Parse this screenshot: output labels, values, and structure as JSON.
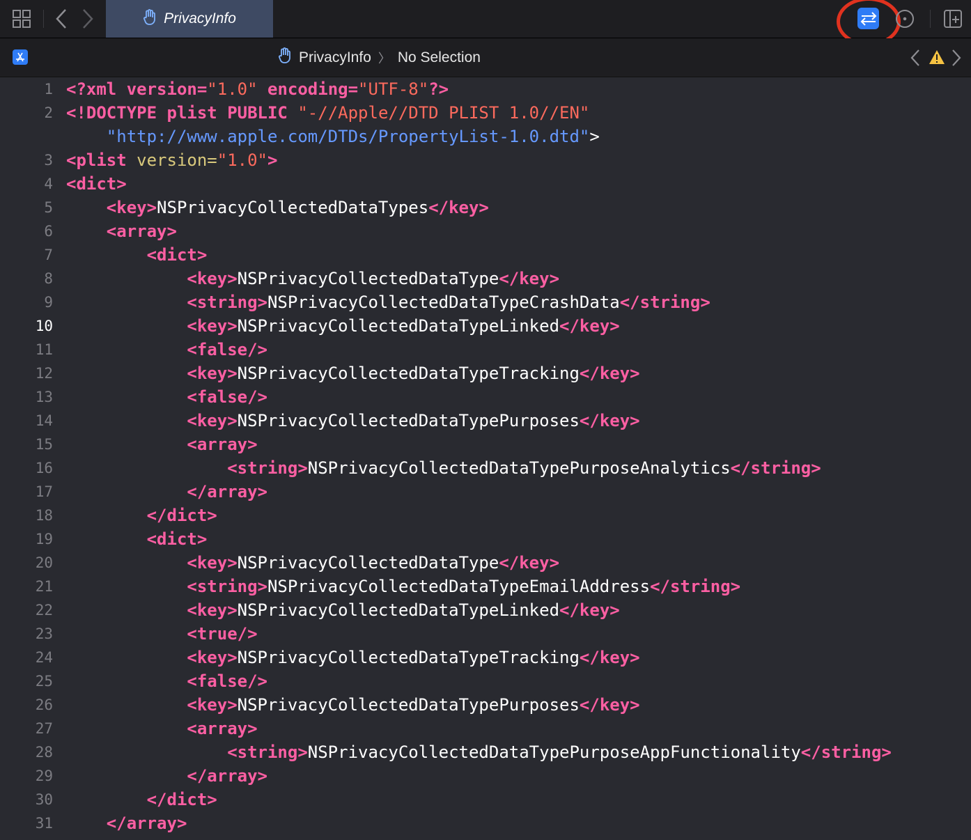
{
  "toolbar": {
    "tab_title": "PrivacyInfo",
    "icons": [
      "grid-icon",
      "back-chevron-icon",
      "forward-chevron-icon",
      "hand-icon",
      "review-changes-icon",
      "more-options-icon",
      "add-editor-icon"
    ]
  },
  "jumpbar": {
    "file": "PrivacyInfo",
    "selection": "No Selection",
    "icons": [
      "app-store-icon",
      "hand-icon",
      "previous-issue-icon",
      "warning-icon",
      "next-issue-icon"
    ]
  },
  "colors": {
    "tag": "#fc5fa3",
    "string": "#fc6a5d",
    "url": "#6699ff",
    "accent": "#2f7cf6",
    "highlight_ring": "#e0321f"
  },
  "editor": {
    "current_line": 10,
    "lines": [
      {
        "n": "1",
        "text": "<?xml version=\"1.0\" encoding=\"UTF-8\"?>"
      },
      {
        "n": "2",
        "text": "<!DOCTYPE plist PUBLIC \"-//Apple//DTD PLIST 1.0//EN\""
      },
      {
        "n": "",
        "text": "    \"http://www.apple.com/DTDs/PropertyList-1.0.dtd\">"
      },
      {
        "n": "3",
        "text": "<plist version=\"1.0\">"
      },
      {
        "n": "4",
        "text": "<dict>"
      },
      {
        "n": "5",
        "text": "    <key>NSPrivacyCollectedDataTypes</key>"
      },
      {
        "n": "6",
        "text": "    <array>"
      },
      {
        "n": "7",
        "text": "        <dict>"
      },
      {
        "n": "8",
        "text": "            <key>NSPrivacyCollectedDataType</key>"
      },
      {
        "n": "9",
        "text": "            <string>NSPrivacyCollectedDataTypeCrashData</string>"
      },
      {
        "n": "10",
        "text": "            <key>NSPrivacyCollectedDataTypeLinked</key>"
      },
      {
        "n": "11",
        "text": "            <false/>"
      },
      {
        "n": "12",
        "text": "            <key>NSPrivacyCollectedDataTypeTracking</key>"
      },
      {
        "n": "13",
        "text": "            <false/>"
      },
      {
        "n": "14",
        "text": "            <key>NSPrivacyCollectedDataTypePurposes</key>"
      },
      {
        "n": "15",
        "text": "            <array>"
      },
      {
        "n": "16",
        "text": "                <string>NSPrivacyCollectedDataTypePurposeAnalytics</string>"
      },
      {
        "n": "17",
        "text": "            </array>"
      },
      {
        "n": "18",
        "text": "        </dict>"
      },
      {
        "n": "19",
        "text": "        <dict>"
      },
      {
        "n": "20",
        "text": "            <key>NSPrivacyCollectedDataType</key>"
      },
      {
        "n": "21",
        "text": "            <string>NSPrivacyCollectedDataTypeEmailAddress</string>"
      },
      {
        "n": "22",
        "text": "            <key>NSPrivacyCollectedDataTypeLinked</key>"
      },
      {
        "n": "23",
        "text": "            <true/>"
      },
      {
        "n": "24",
        "text": "            <key>NSPrivacyCollectedDataTypeTracking</key>"
      },
      {
        "n": "25",
        "text": "            <false/>"
      },
      {
        "n": "26",
        "text": "            <key>NSPrivacyCollectedDataTypePurposes</key>"
      },
      {
        "n": "27",
        "text": "            <array>"
      },
      {
        "n": "28",
        "text": "                <string>NSPrivacyCollectedDataTypePurposeAppFunctionality</string>"
      },
      {
        "n": "29",
        "text": "            </array>"
      },
      {
        "n": "30",
        "text": "        </dict>"
      },
      {
        "n": "31",
        "text": "    </array>"
      }
    ]
  }
}
